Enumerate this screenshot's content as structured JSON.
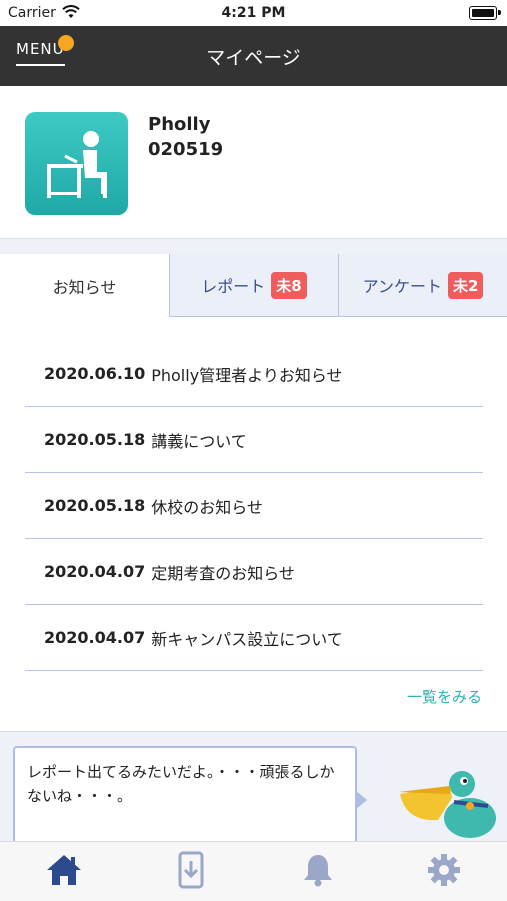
{
  "status_bar": {
    "carrier": "Carrier",
    "time": "4:21 PM"
  },
  "navbar": {
    "menu_label": "MENU",
    "title": "マイページ"
  },
  "profile": {
    "name": "Pholly",
    "id": "020519"
  },
  "tabs": [
    {
      "label": "お知らせ",
      "badge": ""
    },
    {
      "label": "レポート",
      "badge": "未8"
    },
    {
      "label": "アンケート",
      "badge": "未2"
    }
  ],
  "news": [
    {
      "date": "2020.06.10",
      "title": "Pholly管理者よりお知らせ"
    },
    {
      "date": "2020.05.18",
      "title": "講義について"
    },
    {
      "date": "2020.05.18",
      "title": "休校のお知らせ"
    },
    {
      "date": "2020.04.07",
      "title": "定期考査のお知らせ"
    },
    {
      "date": "2020.04.07",
      "title": "新キャンパス設立について"
    }
  ],
  "more_link": "一覧をみる",
  "mascot_message": "レポート出てるみたいだよ。・・・頑張るしかないね・・・。",
  "icons": {
    "home": "home-icon",
    "report": "phone-download-icon",
    "bell": "bell-icon",
    "settings": "gear-icon"
  },
  "colors": {
    "navbar_bg": "#333333",
    "menu_dot": "#f5a623",
    "teal": "#2bb3b0",
    "badge_red": "#ef5c5c",
    "tab_text": "#3a4f8f",
    "home_icon_active": "#2e4a8f",
    "inactive_icon": "#9aa7c9"
  }
}
